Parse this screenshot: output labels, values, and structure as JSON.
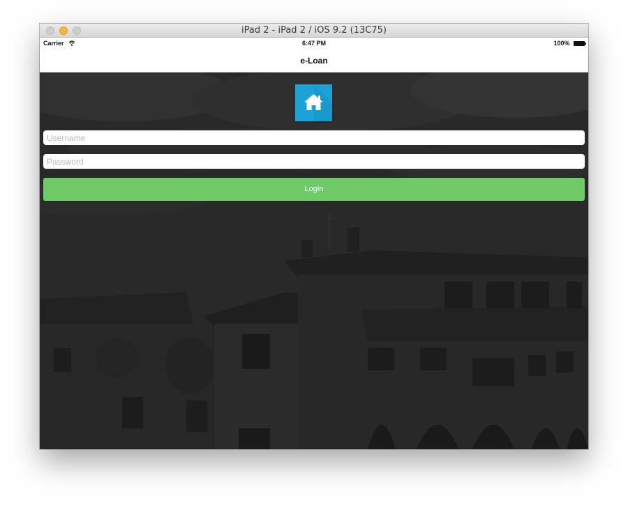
{
  "window": {
    "title": "iPad 2 - iPad 2 / iOS 9.2 (13C75)"
  },
  "statusbar": {
    "carrier": "Carrier",
    "time": "6:47 PM",
    "battery": "100%",
    "wifi_icon": "wifi-icon",
    "battery_icon": "battery-icon"
  },
  "navbar": {
    "title": "e-Loan"
  },
  "login": {
    "logo_icon": "house-icon",
    "username_placeholder": "Username",
    "password_placeholder": "Password",
    "button_label": "Login"
  },
  "colors": {
    "logo_bg": "#1ba3d8",
    "login_button": "#6fcb68",
    "background_overlay": "#2a2a2a"
  }
}
